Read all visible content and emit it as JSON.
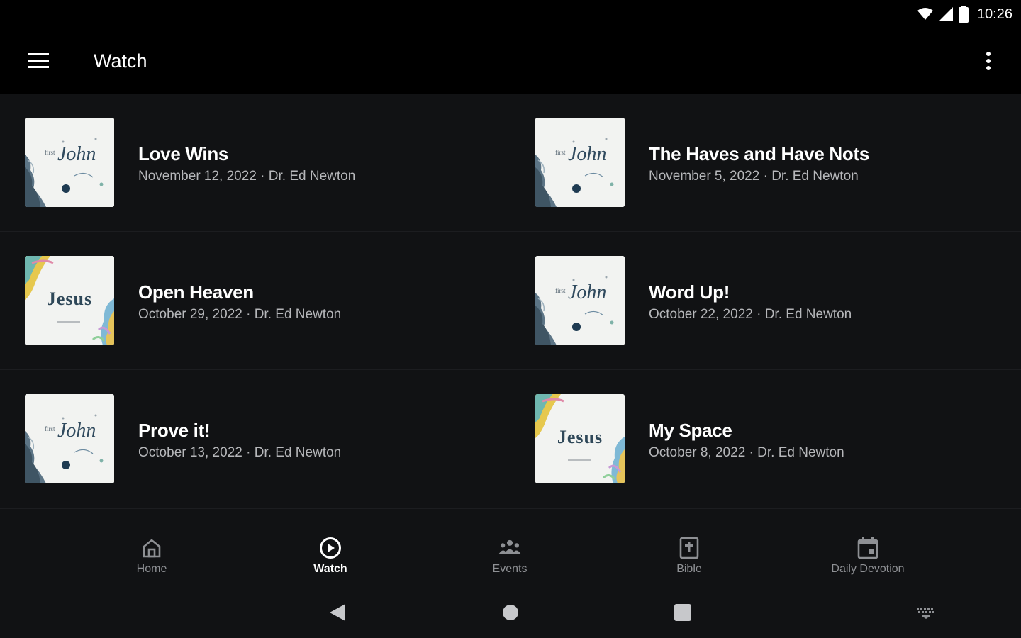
{
  "status_bar": {
    "time": "10:26"
  },
  "app_bar": {
    "title": "Watch"
  },
  "sermons": [
    {
      "title": "Love Wins",
      "subtitle": "November 12, 2022 · Dr. Ed Newton",
      "art": "john"
    },
    {
      "title": "The Haves and Have Nots",
      "subtitle": "November 5, 2022 · Dr. Ed Newton",
      "art": "john"
    },
    {
      "title": "Open Heaven",
      "subtitle": "October 29, 2022 · Dr. Ed Newton",
      "art": "jesus"
    },
    {
      "title": "Word Up!",
      "subtitle": "October 22, 2022 · Dr. Ed Newton",
      "art": "john"
    },
    {
      "title": "Prove it!",
      "subtitle": "October 13, 2022 · Dr. Ed Newton",
      "art": "john"
    },
    {
      "title": "My Space",
      "subtitle": "October 8, 2022 · Dr. Ed Newton",
      "art": "jesus"
    }
  ],
  "art_text": {
    "john_small": "first",
    "john": "John",
    "jesus": "Jesus"
  },
  "bottom_nav": {
    "home": "Home",
    "watch": "Watch",
    "events": "Events",
    "bible": "Bible",
    "daily_devotion": "Daily Devotion",
    "active": "watch"
  },
  "colors": {
    "background": "#111214",
    "app_bar": "#000000",
    "subtitle": "#b6b7ba",
    "nav_inactive": "#8e9094"
  }
}
